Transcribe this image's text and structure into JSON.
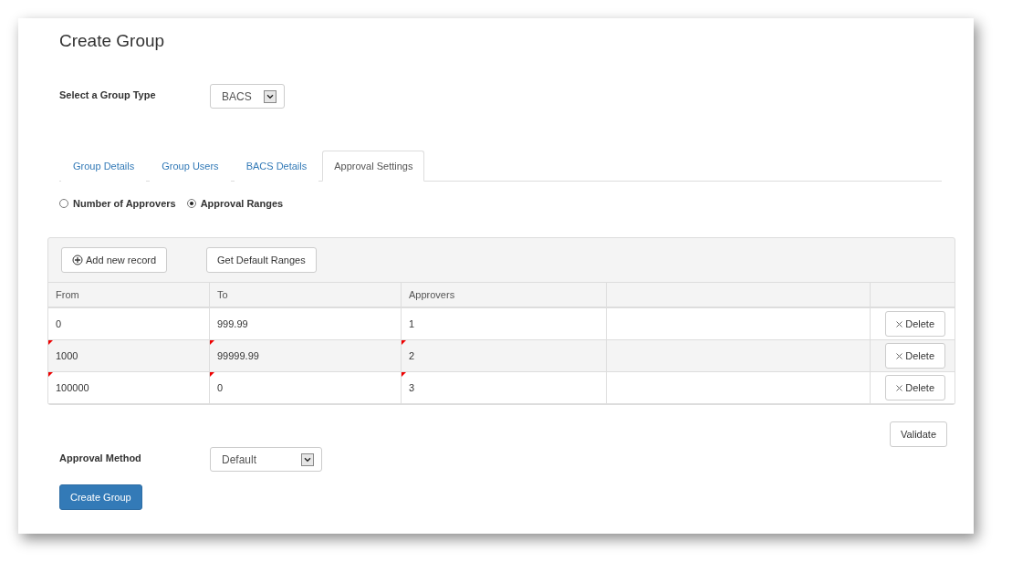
{
  "title": "Create Group",
  "group_type": {
    "label": "Select a Group Type",
    "value": "BACS"
  },
  "tabs": [
    {
      "label": "Group Details",
      "selected": false
    },
    {
      "label": "Group Users",
      "selected": false
    },
    {
      "label": "BACS Details",
      "selected": false
    },
    {
      "label": "Approval Settings",
      "selected": true
    }
  ],
  "radios": [
    {
      "label": "Number of Approvers",
      "selected": false
    },
    {
      "label": "Approval Ranges",
      "selected": true
    }
  ],
  "toolbar": {
    "add_button": "Add new record",
    "default_button": "Get Default Ranges"
  },
  "table": {
    "columns": [
      "From",
      "To",
      "Approvers"
    ],
    "rows": [
      {
        "cells": [
          {
            "text": "0",
            "flagged": false
          },
          {
            "text": "999.99",
            "flagged": false
          },
          {
            "text": "1",
            "flagged": false
          }
        ],
        "action": "Delete"
      },
      {
        "cells": [
          {
            "text": "1000",
            "flagged": true
          },
          {
            "text": "99999.99",
            "flagged": true
          },
          {
            "text": "2",
            "flagged": true
          }
        ],
        "action": "Delete"
      },
      {
        "cells": [
          {
            "text": "100000",
            "flagged": true
          },
          {
            "text": "0",
            "flagged": true
          },
          {
            "text": "3",
            "flagged": true
          }
        ],
        "action": "Delete"
      }
    ]
  },
  "validate_button": "Validate",
  "approval_method": {
    "label": "Approval Method",
    "value": "Default"
  },
  "submit_button": "Create Group"
}
